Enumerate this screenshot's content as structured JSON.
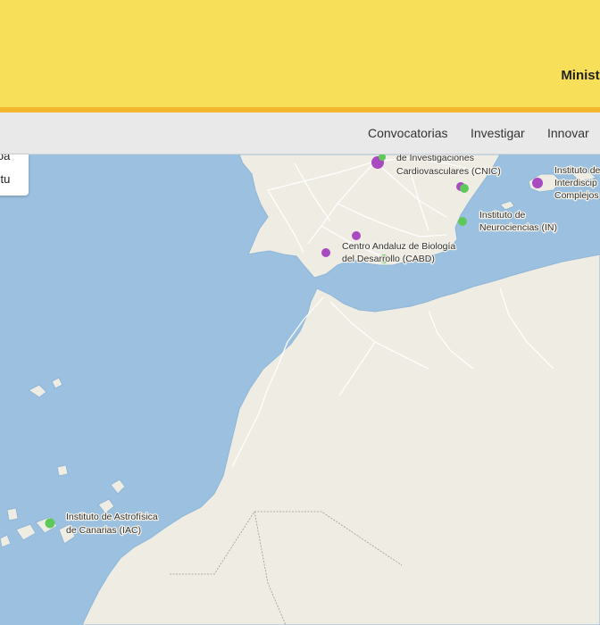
{
  "header": {
    "ministry_text": "Ministe"
  },
  "nav": {
    "items": [
      {
        "label": "Convocatorias"
      },
      {
        "label": "Investigar"
      },
      {
        "label": "Innovar"
      }
    ]
  },
  "legend": {
    "line1": "ioa",
    "line2": "ztu"
  },
  "map": {
    "colors": {
      "sea": "#9cc1e0",
      "land": "#eeece3",
      "purple_marker": "#a94ac0",
      "green_marker": "#5ec95a"
    },
    "labels": [
      {
        "id": "cnic",
        "lines": [
          "de Investigaciones",
          "Cardiovasculares (CNIC)"
        ]
      },
      {
        "id": "interdisc",
        "lines": [
          "Instituto de",
          "Interdiscip",
          "Complejos"
        ]
      },
      {
        "id": "in",
        "lines": [
          "Instituto de",
          "Neurociencias (IN)"
        ]
      },
      {
        "id": "cabd",
        "lines": [
          "Centro Andaluz de Biología",
          "del Desarrollo (CABD)"
        ]
      },
      {
        "id": "iac",
        "lines": [
          "Instituto de Astrofísica",
          "de Canarias (IAC)"
        ]
      }
    ]
  }
}
